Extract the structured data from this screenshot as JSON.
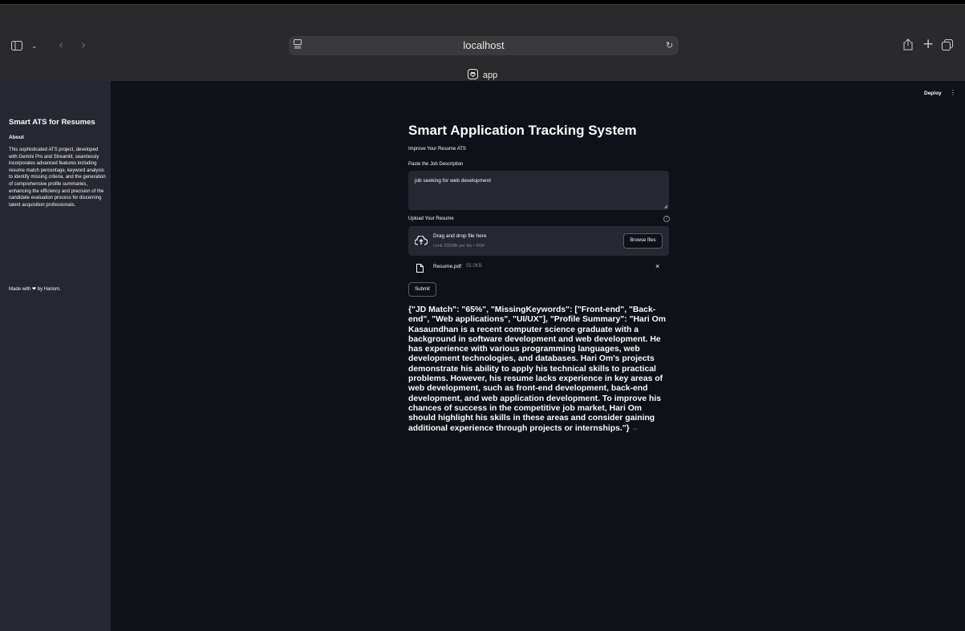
{
  "browser": {
    "url": "localhost",
    "tab_title": "app",
    "icons": [
      "sidebar-icon",
      "chevron-down-icon",
      "back-icon",
      "forward-icon",
      "site-settings-icon",
      "reload-icon",
      "share-icon",
      "new-tab-icon",
      "tab-overview-icon"
    ]
  },
  "header": {
    "deploy_label": "Deploy",
    "menu_icon": "⋮"
  },
  "sidebar": {
    "title": "Smart ATS for Resumes",
    "about_heading": "About",
    "about_text": "This sophisticated ATS project, developed with Gemini Pro and Streamlit, seamlessly incorporates advanced features including resume match percentage, keyword analysis to identify missing criteria, and the generation of comprehensive profile summaries, enhancing the efficiency and precision of the candidate evaluation process for discerning talent acquisition professionals.",
    "made_with_prefix": "Made with",
    "made_with_suffix": "by Hariom."
  },
  "main": {
    "title": "Smart Application Tracking System",
    "subtitle": "Improve Your Resume ATS",
    "jd_label": "Paste the Job Description",
    "jd_value": "job seeking for web development",
    "upload_label": "Upload Your Resume",
    "dropzone_text": "Drag and drop file here",
    "dropzone_limit": "Limit 200MB per file • PDF",
    "browse_label": "Browse files",
    "file_name": "Resume.pdf",
    "file_size": "55.0KB",
    "submit_label": "Submit",
    "result_text": "{\"JD Match\": \"65%\", \"MissingKeywords\": [\"Front-end\", \"Back-end\", \"Web applications\", \"UI/UX\"], \"Profile Summary\": \"Hari Om Kasaundhan is a recent computer science graduate with a background in software development and web development. He has experience with various programming languages, web development technologies, and databases. Hari Om's projects demonstrate his ability to apply his technical skills to practical problems. However, his resume lacks experience in key areas of web development, such as front-end development, back-end development, and web application development. To improve his chances of success in the competitive job market, Hari Om should highlight his skills in these areas and consider gaining additional experience through projects or internships.\"}"
  },
  "colors": {
    "app_bg": "#0e1117",
    "sidebar_bg": "#262730",
    "input_bg": "#262730",
    "text": "#fafafa",
    "muted": "#808495",
    "browser_chrome": "#2a2a2c"
  }
}
